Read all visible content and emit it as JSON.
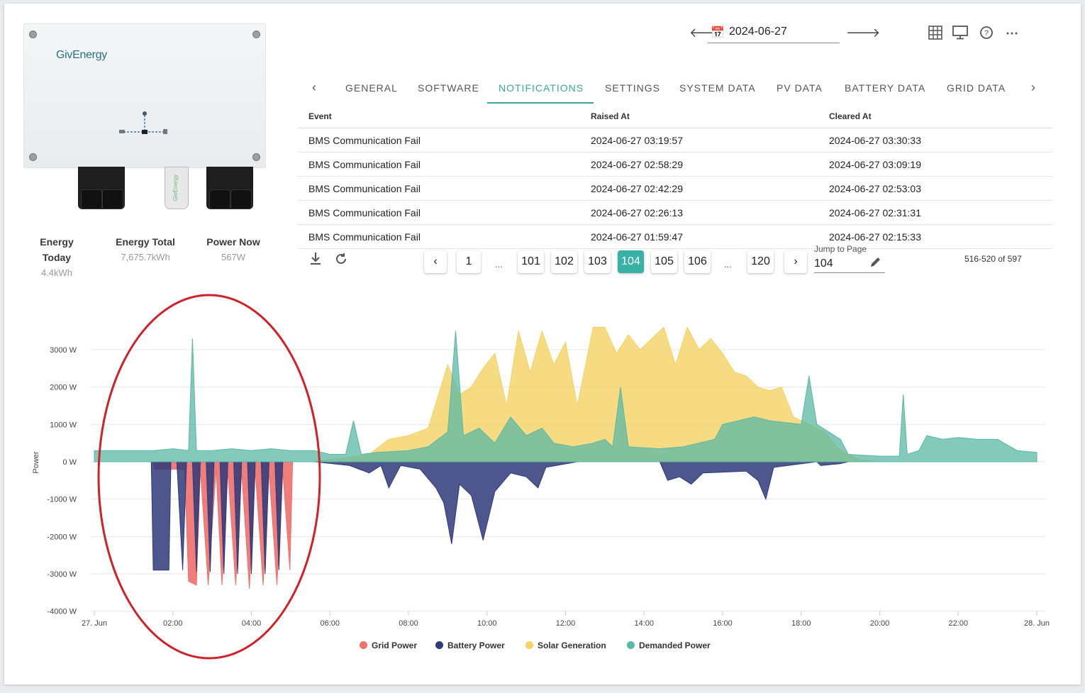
{
  "device": {
    "brand": "GivEnergy",
    "dongle_text": "GivEnergy"
  },
  "stats": [
    {
      "label": "Energy Today",
      "value": "4.4kWh"
    },
    {
      "label": "Energy Total",
      "value": "7,675.7kWh"
    },
    {
      "label": "Power Now",
      "value": "567W"
    }
  ],
  "header": {
    "date": "2024-06-27",
    "icons": [
      "calendar-icon",
      "grid-view-icon",
      "monitor-icon",
      "support-icon",
      "more-icon"
    ]
  },
  "tabs": [
    "GENERAL",
    "SOFTWARE",
    "NOTIFICATIONS",
    "SETTINGS",
    "SYSTEM DATA",
    "PV DATA",
    "BATTERY DATA",
    "GRID DATA"
  ],
  "active_tab": "NOTIFICATIONS",
  "table": {
    "columns": [
      "Event",
      "Raised At",
      "Cleared At"
    ],
    "rows": [
      [
        "BMS Communication Fail",
        "2024-06-27 03:19:57",
        "2024-06-27 03:30:33"
      ],
      [
        "BMS Communication Fail",
        "2024-06-27 02:58:29",
        "2024-06-27 03:09:19"
      ],
      [
        "BMS Communication Fail",
        "2024-06-27 02:42:29",
        "2024-06-27 02:53:03"
      ],
      [
        "BMS Communication Fail",
        "2024-06-27 02:26:13",
        "2024-06-27 02:31:31"
      ],
      [
        "BMS Communication Fail",
        "2024-06-27 01:59:47",
        "2024-06-27 02:15:33"
      ]
    ]
  },
  "pager": {
    "pages": [
      "1",
      "...",
      "101",
      "102",
      "103",
      "104",
      "105",
      "106",
      "...",
      "120"
    ],
    "current": "104",
    "jump_label": "Jump to Page",
    "jump_value": "104",
    "count": "516-520 of 597"
  },
  "chart_data": {
    "type": "area",
    "ylabel": "Power",
    "y_ticks": [
      "3000 W",
      "2000 W",
      "1000 W",
      "0 W",
      "-1000 W",
      "-2000 W",
      "-3000 W",
      "-4000 W"
    ],
    "x_ticks": [
      "27. Jun",
      "02:00",
      "04:00",
      "06:00",
      "08:00",
      "10:00",
      "12:00",
      "14:00",
      "16:00",
      "18:00",
      "20:00",
      "22:00",
      "28. Jun"
    ],
    "ylim": [
      -4000,
      3000
    ],
    "x_unit": "hours",
    "series": [
      {
        "name": "Grid Power",
        "color": "#ef6f6c",
        "points": [
          [
            0,
            0
          ],
          [
            1.5,
            0
          ],
          [
            1.55,
            -200
          ],
          [
            2.3,
            -200
          ],
          [
            2.4,
            -3200
          ],
          [
            2.6,
            -3300
          ],
          [
            2.7,
            -200
          ],
          [
            2.9,
            -3300
          ],
          [
            3.1,
            -200
          ],
          [
            3.25,
            -3300
          ],
          [
            3.4,
            -250
          ],
          [
            3.6,
            -3300
          ],
          [
            3.75,
            -250
          ],
          [
            3.95,
            -3400
          ],
          [
            4.1,
            -250
          ],
          [
            4.3,
            -3300
          ],
          [
            4.45,
            -250
          ],
          [
            4.65,
            -3300
          ],
          [
            4.8,
            -250
          ],
          [
            4.98,
            -2900
          ],
          [
            5.05,
            0
          ],
          [
            17,
            0
          ],
          [
            24,
            0
          ]
        ]
      },
      {
        "name": "Battery Power",
        "color": "#2e3a7a",
        "points": [
          [
            0,
            0
          ],
          [
            1.45,
            0
          ],
          [
            1.5,
            -2900
          ],
          [
            1.9,
            -2900
          ],
          [
            1.95,
            0
          ],
          [
            2.1,
            0
          ],
          [
            2.25,
            -2900
          ],
          [
            2.35,
            0
          ],
          [
            2.5,
            0
          ],
          [
            2.6,
            -2950
          ],
          [
            2.7,
            0
          ],
          [
            2.85,
            0
          ],
          [
            2.95,
            -2950
          ],
          [
            3.05,
            0
          ],
          [
            3.2,
            0
          ],
          [
            3.3,
            -3000
          ],
          [
            3.4,
            0
          ],
          [
            3.55,
            0
          ],
          [
            3.65,
            -3000
          ],
          [
            3.75,
            0
          ],
          [
            3.9,
            0
          ],
          [
            4.0,
            -3000
          ],
          [
            4.1,
            0
          ],
          [
            4.25,
            0
          ],
          [
            4.35,
            -3000
          ],
          [
            4.45,
            0
          ],
          [
            4.6,
            0
          ],
          [
            4.7,
            -2900
          ],
          [
            4.8,
            0
          ],
          [
            5.6,
            0
          ],
          [
            6.5,
            -100
          ],
          [
            7.0,
            -300
          ],
          [
            7.3,
            -100
          ],
          [
            7.5,
            -700
          ],
          [
            7.8,
            -100
          ],
          [
            8.3,
            -200
          ],
          [
            8.7,
            -700
          ],
          [
            8.9,
            -1100
          ],
          [
            9.1,
            -2200
          ],
          [
            9.3,
            -600
          ],
          [
            9.6,
            -900
          ],
          [
            9.9,
            -2100
          ],
          [
            10.2,
            -800
          ],
          [
            10.6,
            -300
          ],
          [
            11.0,
            -400
          ],
          [
            11.3,
            -700
          ],
          [
            11.5,
            -150
          ],
          [
            12.3,
            0
          ],
          [
            14.4,
            0
          ],
          [
            14.6,
            -500
          ],
          [
            14.9,
            -400
          ],
          [
            15.2,
            -600
          ],
          [
            15.5,
            -300
          ],
          [
            16.6,
            -250
          ],
          [
            16.9,
            -500
          ],
          [
            17.1,
            -1000
          ],
          [
            17.3,
            -150
          ],
          [
            18.4,
            0
          ],
          [
            18.5,
            -100
          ],
          [
            19.0,
            -50
          ],
          [
            19.2,
            0
          ],
          [
            24,
            0
          ]
        ]
      },
      {
        "name": "Solar Generation",
        "color": "#f5d264",
        "points": [
          [
            0,
            0
          ],
          [
            5.5,
            0
          ],
          [
            6.4,
            100
          ],
          [
            7.0,
            200
          ],
          [
            7.5,
            600
          ],
          [
            8.0,
            700
          ],
          [
            8.5,
            900
          ],
          [
            9.0,
            2600
          ],
          [
            9.3,
            1800
          ],
          [
            9.6,
            2000
          ],
          [
            9.9,
            2500
          ],
          [
            10.2,
            2900
          ],
          [
            10.5,
            1500
          ],
          [
            10.8,
            3500
          ],
          [
            11.1,
            2400
          ],
          [
            11.4,
            3500
          ],
          [
            11.7,
            2600
          ],
          [
            12.0,
            3200
          ],
          [
            12.3,
            1500
          ],
          [
            12.7,
            3600
          ],
          [
            13.0,
            3600
          ],
          [
            13.3,
            2900
          ],
          [
            13.6,
            3400
          ],
          [
            13.9,
            3000
          ],
          [
            14.2,
            3300
          ],
          [
            14.5,
            3600
          ],
          [
            14.8,
            2600
          ],
          [
            15.1,
            3600
          ],
          [
            15.4,
            3000
          ],
          [
            15.7,
            3300
          ],
          [
            16.0,
            2900
          ],
          [
            16.3,
            2400
          ],
          [
            16.6,
            2300
          ],
          [
            16.9,
            2000
          ],
          [
            17.2,
            1900
          ],
          [
            17.5,
            2000
          ],
          [
            17.8,
            1200
          ],
          [
            18.2,
            1000
          ],
          [
            18.6,
            800
          ],
          [
            19.0,
            300
          ],
          [
            19.5,
            50
          ],
          [
            20.0,
            0
          ],
          [
            24,
            0
          ]
        ]
      },
      {
        "name": "Demanded Power",
        "color": "#5ab8a4",
        "points": [
          [
            0,
            300
          ],
          [
            1.0,
            300
          ],
          [
            1.5,
            300
          ],
          [
            2.0,
            350
          ],
          [
            2.4,
            300
          ],
          [
            2.5,
            3300
          ],
          [
            2.6,
            300
          ],
          [
            3.0,
            300
          ],
          [
            3.5,
            350
          ],
          [
            4.0,
            300
          ],
          [
            4.5,
            350
          ],
          [
            5.0,
            300
          ],
          [
            5.6,
            300
          ],
          [
            6.0,
            200
          ],
          [
            6.4,
            200
          ],
          [
            6.6,
            1100
          ],
          [
            6.8,
            200
          ],
          [
            7.2,
            250
          ],
          [
            8.0,
            300
          ],
          [
            8.5,
            400
          ],
          [
            9.0,
            800
          ],
          [
            9.2,
            3500
          ],
          [
            9.4,
            700
          ],
          [
            9.8,
            900
          ],
          [
            10.2,
            500
          ],
          [
            10.6,
            1200
          ],
          [
            11.0,
            700
          ],
          [
            11.4,
            900
          ],
          [
            11.7,
            500
          ],
          [
            12.2,
            400
          ],
          [
            12.7,
            500
          ],
          [
            13.0,
            600
          ],
          [
            13.2,
            400
          ],
          [
            13.4,
            2000
          ],
          [
            13.6,
            400
          ],
          [
            14.4,
            350
          ],
          [
            15.0,
            400
          ],
          [
            15.8,
            600
          ],
          [
            16.0,
            1000
          ],
          [
            16.4,
            1100
          ],
          [
            16.8,
            1200
          ],
          [
            17.2,
            1100
          ],
          [
            17.6,
            1050
          ],
          [
            18.0,
            1000
          ],
          [
            18.2,
            2300
          ],
          [
            18.4,
            1000
          ],
          [
            19.0,
            600
          ],
          [
            19.2,
            200
          ],
          [
            20.0,
            150
          ],
          [
            20.5,
            150
          ],
          [
            20.6,
            1800
          ],
          [
            20.7,
            200
          ],
          [
            21.0,
            300
          ],
          [
            21.2,
            700
          ],
          [
            21.6,
            600
          ],
          [
            22.0,
            650
          ],
          [
            22.5,
            600
          ],
          [
            23.0,
            600
          ],
          [
            23.5,
            300
          ],
          [
            24,
            250
          ]
        ]
      }
    ]
  }
}
